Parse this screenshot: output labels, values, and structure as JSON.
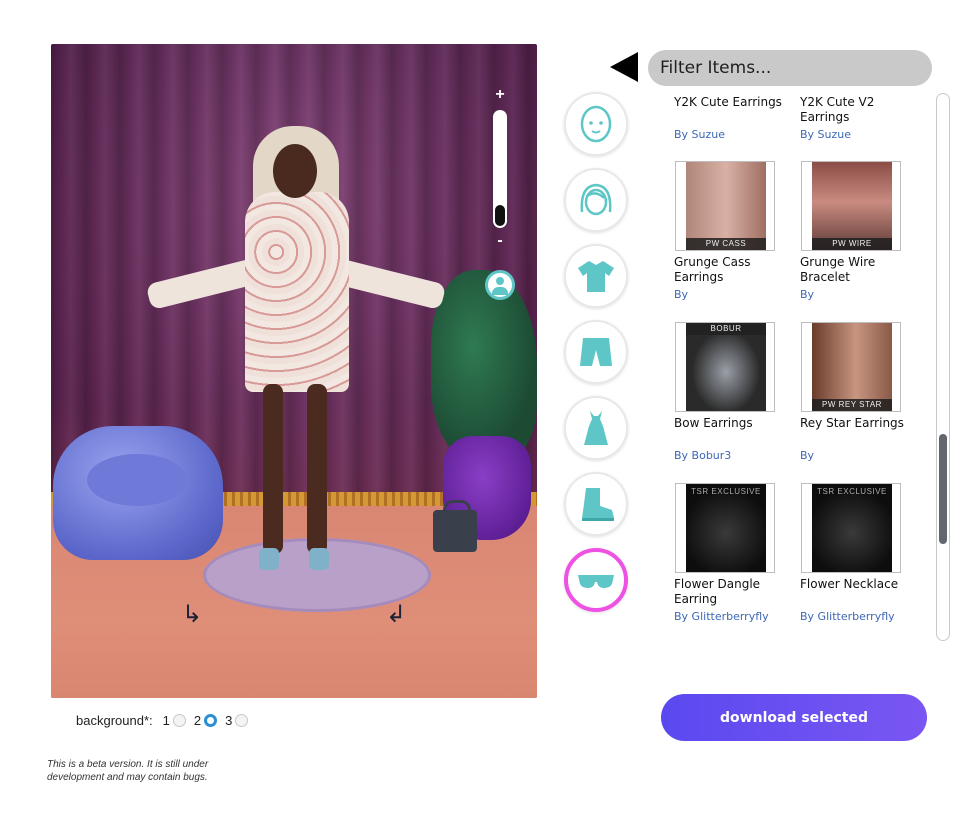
{
  "scene": {
    "zoom_plus": "+",
    "zoom_minus": "-",
    "zoom_level": 0.18
  },
  "background": {
    "label": "background*:",
    "options": [
      "1",
      "2",
      "3"
    ],
    "selected": "2"
  },
  "beta_note": "This is a beta version. It is still under development and may contain bugs.",
  "categories": [
    {
      "icon": "face-icon"
    },
    {
      "icon": "hair-icon"
    },
    {
      "icon": "shirt-icon"
    },
    {
      "icon": "shorts-icon"
    },
    {
      "icon": "dress-icon"
    },
    {
      "icon": "boot-icon"
    },
    {
      "icon": "sunglasses-icon",
      "active": true
    }
  ],
  "filter": {
    "placeholder": "Filter Items..."
  },
  "items": [
    {
      "title": "Y2K Cute Earrings",
      "by": "By Suzue"
    },
    {
      "title": "Y2K Cute V2 Earrings",
      "by": "By Suzue"
    },
    {
      "title": "Grunge Cass Earrings",
      "by": "By",
      "caption": "PW CASS"
    },
    {
      "title": "Grunge Wire Bracelet",
      "by": "By",
      "caption": "PW WIRE BRACELET"
    },
    {
      "title": "Bow Earrings",
      "by": "By Bobur3",
      "caption": "BOBUR"
    },
    {
      "title": "Rey Star Earrings",
      "by": "By",
      "caption": "PW REY STAR"
    },
    {
      "title": "Flower Dangle Earring",
      "by": "By Glitterberryfly",
      "caption": "TSR EXCLUSIVE"
    },
    {
      "title": "Flower Necklace",
      "by": "By Glitterberryfly",
      "caption": "TSR EXCLUSIVE"
    }
  ],
  "download_label": "download selected",
  "colors": {
    "accent": "#5a49f0",
    "active_ring": "#ee52e2",
    "icon_teal": "#5ec6c6",
    "link": "#3e67b7"
  }
}
